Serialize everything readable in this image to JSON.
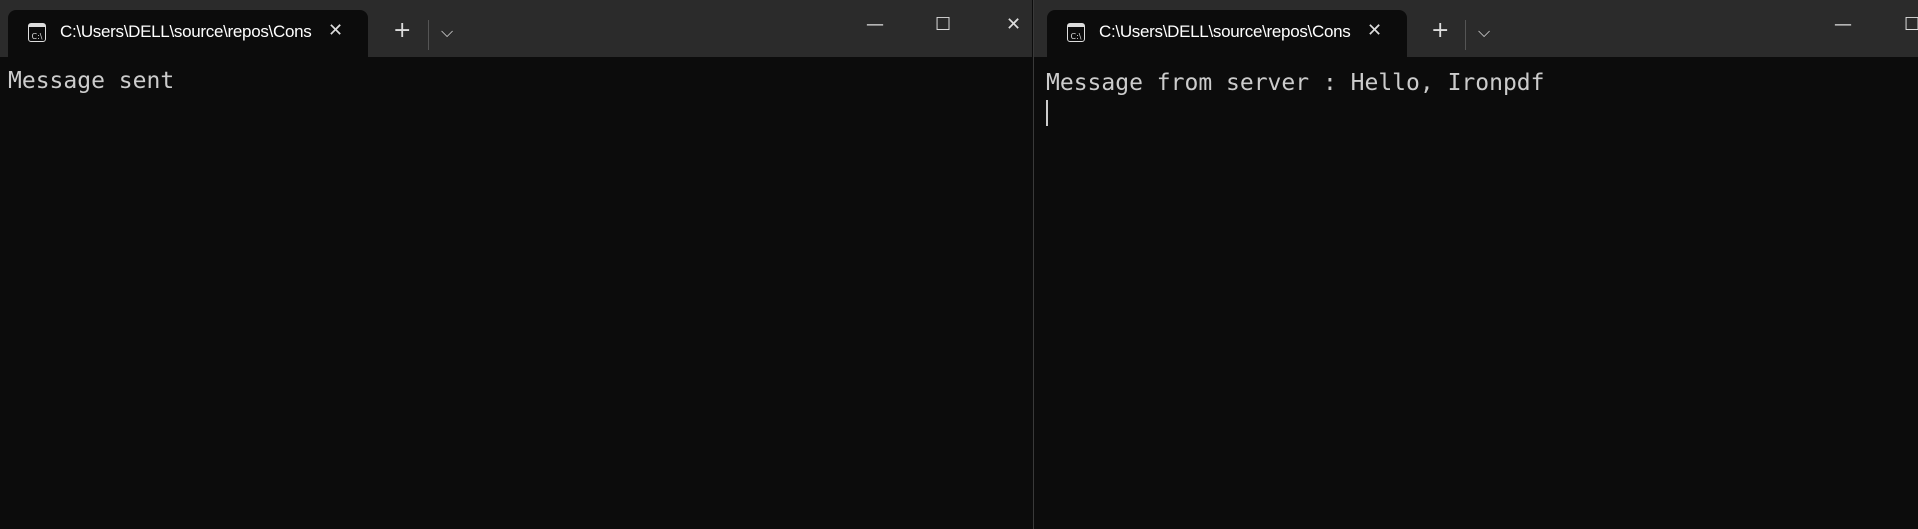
{
  "left_window": {
    "tab_title": "C:\\Users\\DELL\\source\\repos\\ConsoleApp",
    "tab_icon": "console-icon",
    "output": "Message sent"
  },
  "right_window": {
    "tab_title": "C:\\Users\\DELL\\source\\repos\\ConsoleApp",
    "tab_icon": "console-icon",
    "output": "Message from server : Hello, Ironpdf"
  },
  "icons": {
    "new_tab": "+",
    "dropdown": "⌵",
    "close": "✕",
    "minimize": "—",
    "maximize": "☐",
    "console_glyph": "C:\\"
  },
  "colors": {
    "background": "#0c0c0c",
    "tabstrip": "#2b2b2b",
    "text": "#cccccc"
  }
}
